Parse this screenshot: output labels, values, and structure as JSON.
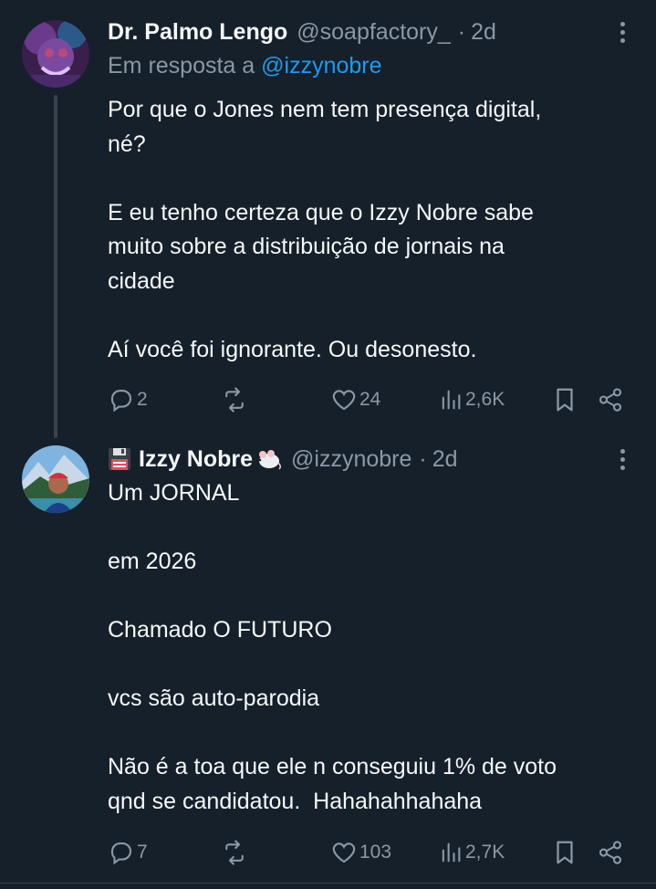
{
  "tweets": [
    {
      "author_name": "Dr. Palmo Lengo",
      "handle": "@soapfactory_",
      "separator": "·",
      "time": "2d",
      "reply_prefix": "Em resposta a",
      "reply_handle": "@izzynobre",
      "text": "Por que o Jones nem tem presença digital,\nné?\n\nE eu tenho certeza que o Izzy Nobre sabe\nmuito sobre a distribuição de jornais na\ncidade\n\nAí você foi ignorante. Ou desonesto.",
      "replies": "2",
      "retweets": "",
      "likes": "24",
      "views": "2,6K"
    },
    {
      "author_name": "Izzy Nobre",
      "handle": "@izzynobre",
      "separator": "·",
      "time": "2d",
      "text": "Um JORNAL\n\nem 2026\n\nChamado O FUTURO\n\nvcs são auto-parodia\n\nNão é a toa que ele n conseguiu 1% de voto\nqnd se candidatou.  Hahahahhahaha",
      "replies": "7",
      "retweets": "",
      "likes": "103",
      "views": "2,7K"
    }
  ],
  "icons": {
    "reply": "reply-icon",
    "retweet": "retweet-icon",
    "like": "heart-icon",
    "views": "views-icon",
    "bookmark": "bookmark-icon",
    "share": "share-icon",
    "more": "more-icon",
    "name_prefix": "floppy-disk-icon",
    "name_suffix": "mouse-icon"
  },
  "colors": {
    "background": "#15202b",
    "text": "#f7f9f9",
    "secondary": "#8b98a5",
    "link": "#1d9bf0",
    "divider": "#38444d"
  }
}
